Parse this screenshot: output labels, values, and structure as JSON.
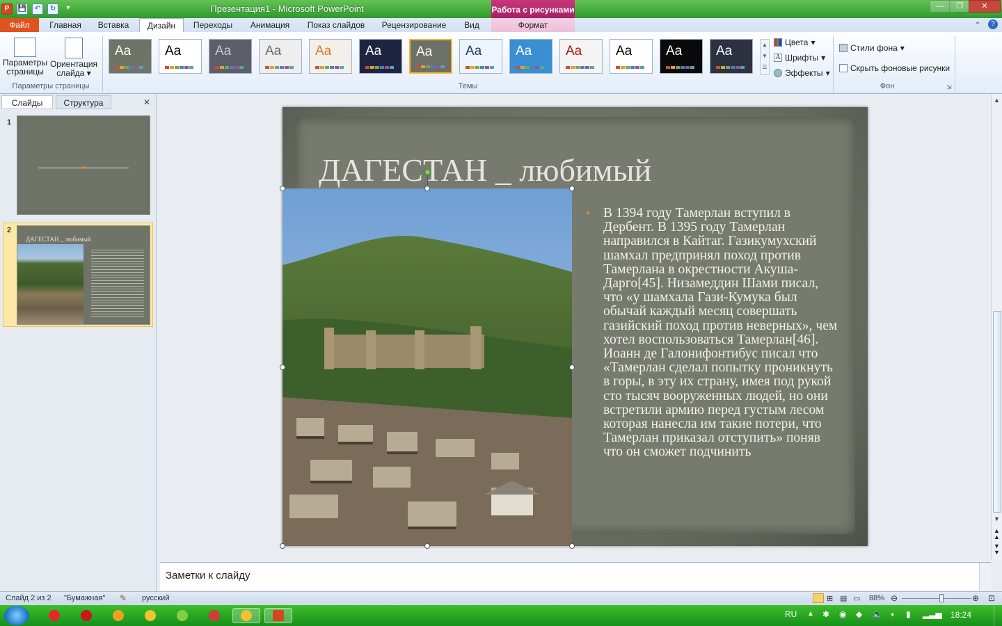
{
  "app": {
    "title": "Презентация1 - Microsoft PowerPoint",
    "context_tab_header": "Работа с рисунками",
    "window_buttons": {
      "minimize": "—",
      "restore": "❐",
      "close": "✕"
    },
    "qat": {
      "save": "💾",
      "undo": "↶",
      "redo": "↻",
      "customize": "▾"
    }
  },
  "ribbon_tabs": [
    {
      "label": "Файл"
    },
    {
      "label": "Главная"
    },
    {
      "label": "Вставка"
    },
    {
      "label": "Дизайн"
    },
    {
      "label": "Переходы"
    },
    {
      "label": "Анимация"
    },
    {
      "label": "Показ слайдов"
    },
    {
      "label": "Рецензирование"
    },
    {
      "label": "Вид"
    },
    {
      "label": "Формат"
    }
  ],
  "ribbon": {
    "page_setup": {
      "btn1": "Параметры страницы",
      "btn2": "Ориентация слайда",
      "group": "Параметры страницы"
    },
    "themes_group": "Темы",
    "theme_aa": "Aa",
    "themes": [
      {
        "bg": "#6f7467",
        "fg": "#ffffff"
      },
      {
        "bg": "#ffffff",
        "fg": "#000000"
      },
      {
        "bg": "#5d5f68",
        "fg": "#c9c9d2"
      },
      {
        "bg": "#eeeeee",
        "fg": "#6b6b6b"
      },
      {
        "bg": "#f3f0ea",
        "fg": "#e0742c"
      },
      {
        "bg": "#1f2540",
        "fg": "#ffffff"
      },
      {
        "bg": "#6d7066",
        "fg": "#ffffff"
      },
      {
        "bg": "#eef4fb",
        "fg": "#1a3c6e"
      },
      {
        "bg": "#3a8fd3",
        "fg": "#ffffff"
      },
      {
        "bg": "#f4f4f4",
        "fg": "#b01010"
      },
      {
        "bg": "#ffffff",
        "fg": "#000000"
      },
      {
        "bg": "#0a0a0a",
        "fg": "#ffffff"
      },
      {
        "bg": "#2d3140",
        "fg": "#ffffff"
      }
    ],
    "selected_theme": 6,
    "variants": {
      "colors": "Цвета",
      "fonts": "Шрифты",
      "effects": "Эффекты"
    },
    "background": {
      "styles": "Стили фона",
      "hide": "Скрыть фоновые рисунки",
      "group": "Фон"
    }
  },
  "left_pane": {
    "tabs": [
      "Слайды",
      "Структура"
    ],
    "close": "✕",
    "slides": [
      {
        "num": "1"
      },
      {
        "num": "2",
        "title": "ДАГЕСТАН _ любимый"
      }
    ]
  },
  "slide": {
    "title": "ДАГЕСТАН _ любимый",
    "bullet": "•",
    "body": "В 1394 году  Тамерлан вступил в Дербент. В 1395 году  Тамерлан направился в  Кайтаг. Газикумухский шамхал предпринял поход  против Тамерлана в окрестности Акуша-Дарго[45].  Низамеддин Шами писал, что «у шамхала Гази-Кумука был обычай каждый  месяц совершать газийский поход против неверных», чем хотел воспользоваться Тамерлан[46]. Иоанн де Галонифонтибус писал что «Тамерлан сделал попытку проникнуть в горы,  в эту их страну, имея под  рукой сто тысяч вооруженных людей, но они встретили армию перед густым лесом которая  нанесла им такие потери, что Тамерлан приказал отступить» поняв что он сможет подчинить"
  },
  "notes": {
    "placeholder": "Заметки к слайду"
  },
  "status": {
    "slide_of": "Слайд 2 из 2",
    "theme": "\"Бумажная\"",
    "language": "русский",
    "zoom": "88%",
    "zoom_fraction": 0.57
  },
  "taskbar": {
    "lang": "RU",
    "time": "18:24",
    "apps": [
      {
        "name": "yandex-browser",
        "color": "#e8262a"
      },
      {
        "name": "opera",
        "color": "#d0141c"
      },
      {
        "name": "tool",
        "color": "#f0a020"
      },
      {
        "name": "media",
        "color": "#f2c232"
      },
      {
        "name": "utorrent",
        "color": "#88cc44"
      },
      {
        "name": "app",
        "color": "#d43a3a"
      },
      {
        "name": "chrome",
        "color": "#f3c12b"
      },
      {
        "name": "powerpoint",
        "color": "#d2471f"
      }
    ]
  }
}
